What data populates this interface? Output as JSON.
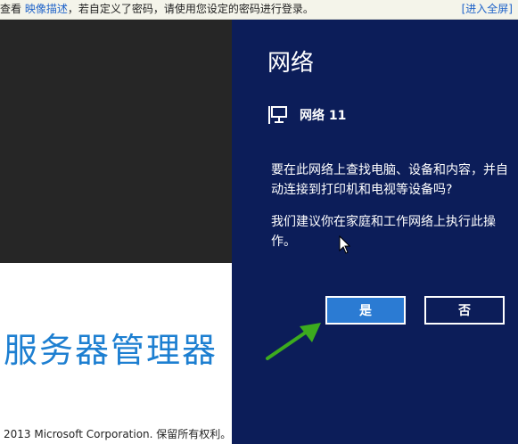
{
  "top_strip": {
    "prefix": "查看",
    "link_text": "映像描述",
    "message": "，若自定义了密码，请使用您设定的密码进行登录。",
    "fullscreen_link": "[进入全屏]"
  },
  "server_manager": {
    "title": "服务器管理器",
    "copyright": "2013 Microsoft Corporation. 保留所有权利。"
  },
  "network_panel": {
    "title": "网络",
    "network_icon": "monitor-network-icon",
    "network_name": "网络  11",
    "question": "要在此网络上查找电脑、设备和内容，并自动连接到打印机和电视等设备吗?",
    "recommendation": "我们建议你在家庭和工作网络上执行此操作。",
    "yes_label": "是",
    "no_label": "否"
  },
  "colors": {
    "panel_bg": "#0c1d59",
    "yes_button_bg": "#2b7bd3",
    "title_blue": "#1d7fd1",
    "link_blue": "#1f63c9",
    "arrow_green": "#3cab1e"
  },
  "annotation": {
    "arrow_icon": "green-arrow-icon",
    "cursor_icon": "mouse-cursor-icon"
  }
}
